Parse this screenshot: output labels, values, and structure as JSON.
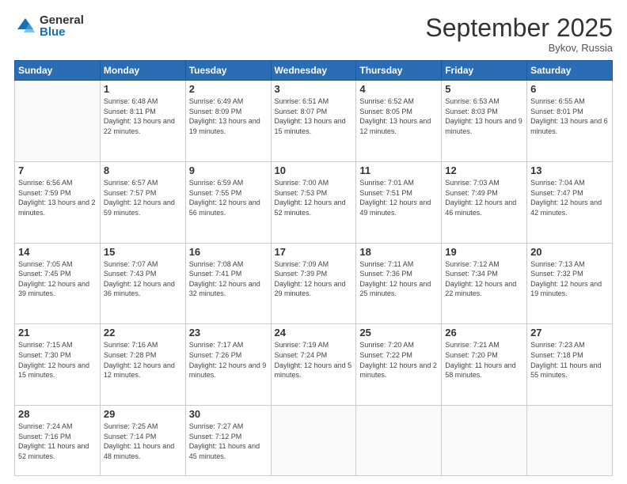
{
  "logo": {
    "general": "General",
    "blue": "Blue"
  },
  "title": "September 2025",
  "location": "Bykov, Russia",
  "days_of_week": [
    "Sunday",
    "Monday",
    "Tuesday",
    "Wednesday",
    "Thursday",
    "Friday",
    "Saturday"
  ],
  "weeks": [
    [
      {
        "day": "",
        "sunrise": "",
        "sunset": "",
        "daylight": ""
      },
      {
        "day": "1",
        "sunrise": "Sunrise: 6:48 AM",
        "sunset": "Sunset: 8:11 PM",
        "daylight": "Daylight: 13 hours and 22 minutes."
      },
      {
        "day": "2",
        "sunrise": "Sunrise: 6:49 AM",
        "sunset": "Sunset: 8:09 PM",
        "daylight": "Daylight: 13 hours and 19 minutes."
      },
      {
        "day": "3",
        "sunrise": "Sunrise: 6:51 AM",
        "sunset": "Sunset: 8:07 PM",
        "daylight": "Daylight: 13 hours and 15 minutes."
      },
      {
        "day": "4",
        "sunrise": "Sunrise: 6:52 AM",
        "sunset": "Sunset: 8:05 PM",
        "daylight": "Daylight: 13 hours and 12 minutes."
      },
      {
        "day": "5",
        "sunrise": "Sunrise: 6:53 AM",
        "sunset": "Sunset: 8:03 PM",
        "daylight": "Daylight: 13 hours and 9 minutes."
      },
      {
        "day": "6",
        "sunrise": "Sunrise: 6:55 AM",
        "sunset": "Sunset: 8:01 PM",
        "daylight": "Daylight: 13 hours and 6 minutes."
      }
    ],
    [
      {
        "day": "7",
        "sunrise": "Sunrise: 6:56 AM",
        "sunset": "Sunset: 7:59 PM",
        "daylight": "Daylight: 13 hours and 2 minutes."
      },
      {
        "day": "8",
        "sunrise": "Sunrise: 6:57 AM",
        "sunset": "Sunset: 7:57 PM",
        "daylight": "Daylight: 12 hours and 59 minutes."
      },
      {
        "day": "9",
        "sunrise": "Sunrise: 6:59 AM",
        "sunset": "Sunset: 7:55 PM",
        "daylight": "Daylight: 12 hours and 56 minutes."
      },
      {
        "day": "10",
        "sunrise": "Sunrise: 7:00 AM",
        "sunset": "Sunset: 7:53 PM",
        "daylight": "Daylight: 12 hours and 52 minutes."
      },
      {
        "day": "11",
        "sunrise": "Sunrise: 7:01 AM",
        "sunset": "Sunset: 7:51 PM",
        "daylight": "Daylight: 12 hours and 49 minutes."
      },
      {
        "day": "12",
        "sunrise": "Sunrise: 7:03 AM",
        "sunset": "Sunset: 7:49 PM",
        "daylight": "Daylight: 12 hours and 46 minutes."
      },
      {
        "day": "13",
        "sunrise": "Sunrise: 7:04 AM",
        "sunset": "Sunset: 7:47 PM",
        "daylight": "Daylight: 12 hours and 42 minutes."
      }
    ],
    [
      {
        "day": "14",
        "sunrise": "Sunrise: 7:05 AM",
        "sunset": "Sunset: 7:45 PM",
        "daylight": "Daylight: 12 hours and 39 minutes."
      },
      {
        "day": "15",
        "sunrise": "Sunrise: 7:07 AM",
        "sunset": "Sunset: 7:43 PM",
        "daylight": "Daylight: 12 hours and 36 minutes."
      },
      {
        "day": "16",
        "sunrise": "Sunrise: 7:08 AM",
        "sunset": "Sunset: 7:41 PM",
        "daylight": "Daylight: 12 hours and 32 minutes."
      },
      {
        "day": "17",
        "sunrise": "Sunrise: 7:09 AM",
        "sunset": "Sunset: 7:39 PM",
        "daylight": "Daylight: 12 hours and 29 minutes."
      },
      {
        "day": "18",
        "sunrise": "Sunrise: 7:11 AM",
        "sunset": "Sunset: 7:36 PM",
        "daylight": "Daylight: 12 hours and 25 minutes."
      },
      {
        "day": "19",
        "sunrise": "Sunrise: 7:12 AM",
        "sunset": "Sunset: 7:34 PM",
        "daylight": "Daylight: 12 hours and 22 minutes."
      },
      {
        "day": "20",
        "sunrise": "Sunrise: 7:13 AM",
        "sunset": "Sunset: 7:32 PM",
        "daylight": "Daylight: 12 hours and 19 minutes."
      }
    ],
    [
      {
        "day": "21",
        "sunrise": "Sunrise: 7:15 AM",
        "sunset": "Sunset: 7:30 PM",
        "daylight": "Daylight: 12 hours and 15 minutes."
      },
      {
        "day": "22",
        "sunrise": "Sunrise: 7:16 AM",
        "sunset": "Sunset: 7:28 PM",
        "daylight": "Daylight: 12 hours and 12 minutes."
      },
      {
        "day": "23",
        "sunrise": "Sunrise: 7:17 AM",
        "sunset": "Sunset: 7:26 PM",
        "daylight": "Daylight: 12 hours and 9 minutes."
      },
      {
        "day": "24",
        "sunrise": "Sunrise: 7:19 AM",
        "sunset": "Sunset: 7:24 PM",
        "daylight": "Daylight: 12 hours and 5 minutes."
      },
      {
        "day": "25",
        "sunrise": "Sunrise: 7:20 AM",
        "sunset": "Sunset: 7:22 PM",
        "daylight": "Daylight: 12 hours and 2 minutes."
      },
      {
        "day": "26",
        "sunrise": "Sunrise: 7:21 AM",
        "sunset": "Sunset: 7:20 PM",
        "daylight": "Daylight: 11 hours and 58 minutes."
      },
      {
        "day": "27",
        "sunrise": "Sunrise: 7:23 AM",
        "sunset": "Sunset: 7:18 PM",
        "daylight": "Daylight: 11 hours and 55 minutes."
      }
    ],
    [
      {
        "day": "28",
        "sunrise": "Sunrise: 7:24 AM",
        "sunset": "Sunset: 7:16 PM",
        "daylight": "Daylight: 11 hours and 52 minutes."
      },
      {
        "day": "29",
        "sunrise": "Sunrise: 7:25 AM",
        "sunset": "Sunset: 7:14 PM",
        "daylight": "Daylight: 11 hours and 48 minutes."
      },
      {
        "day": "30",
        "sunrise": "Sunrise: 7:27 AM",
        "sunset": "Sunset: 7:12 PM",
        "daylight": "Daylight: 11 hours and 45 minutes."
      },
      {
        "day": "",
        "sunrise": "",
        "sunset": "",
        "daylight": ""
      },
      {
        "day": "",
        "sunrise": "",
        "sunset": "",
        "daylight": ""
      },
      {
        "day": "",
        "sunrise": "",
        "sunset": "",
        "daylight": ""
      },
      {
        "day": "",
        "sunrise": "",
        "sunset": "",
        "daylight": ""
      }
    ]
  ]
}
